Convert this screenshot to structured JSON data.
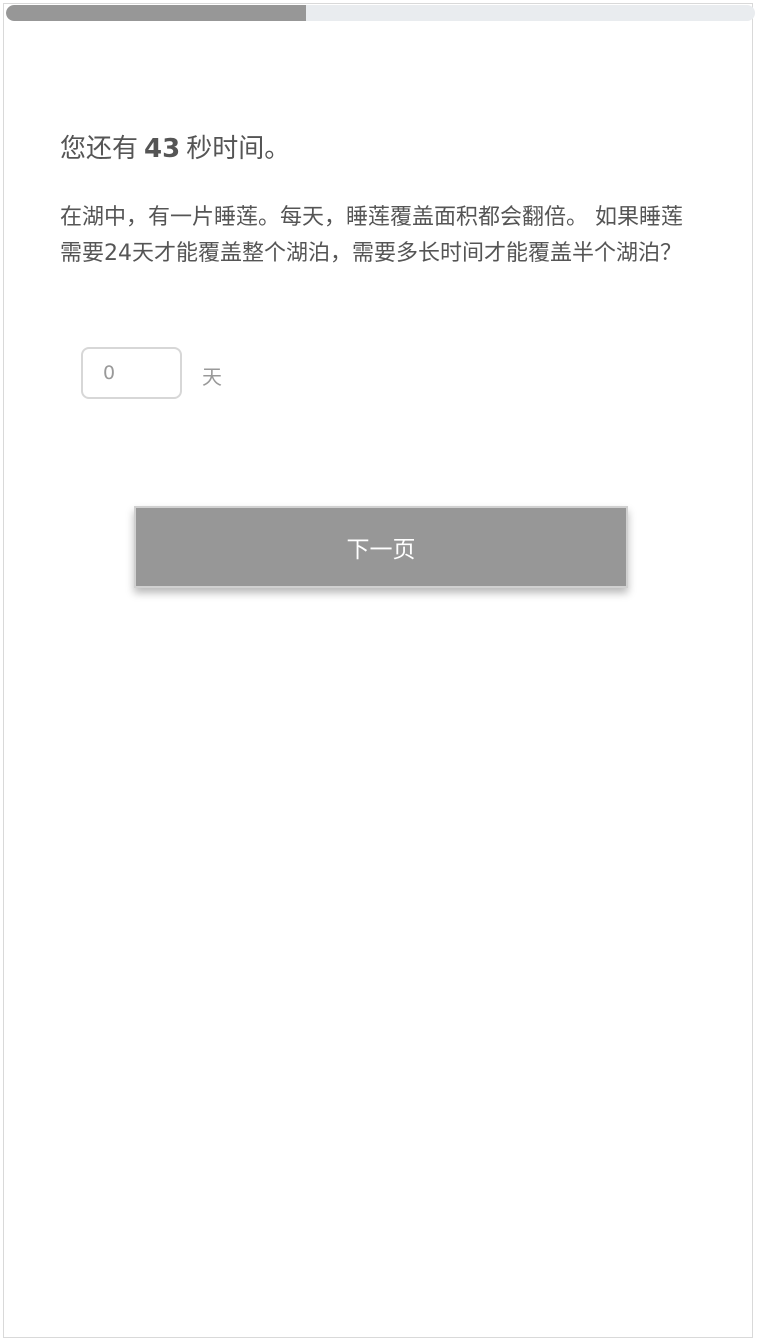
{
  "progress": {
    "fraction": 0.4,
    "fill_color": "#979797",
    "track_color": "#e9ecef"
  },
  "timer": {
    "prefix": "您还有",
    "seconds": "43",
    "suffix": "秒时间。"
  },
  "question": {
    "text": "在湖中，有一片睡莲。每天，睡莲覆盖面积都会翻倍。 如果睡莲需要24天才能覆盖整个湖泊，需要多长时间才能覆盖半个湖泊？"
  },
  "answer": {
    "placeholder": "0",
    "value": "",
    "unit": "天"
  },
  "navigation": {
    "next_label": "下一页"
  }
}
